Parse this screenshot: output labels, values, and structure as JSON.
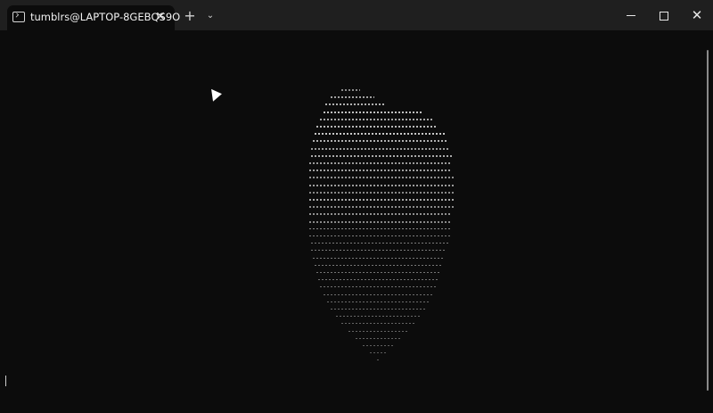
{
  "tab": {
    "icon": "terminal-icon",
    "title": "tumblrs@LAPTOP-8GEBQS9O",
    "close_label": "✕"
  },
  "tab_bar": {
    "new_tab_label": "+",
    "dropdown_label": "⌄"
  },
  "window_controls": {
    "close_label": "✕"
  },
  "terminal": {
    "background": "#0c0c0c",
    "foreground": "#cccccc",
    "content_description": "ASCII-art rendering made of dots, colons and dashes"
  }
}
